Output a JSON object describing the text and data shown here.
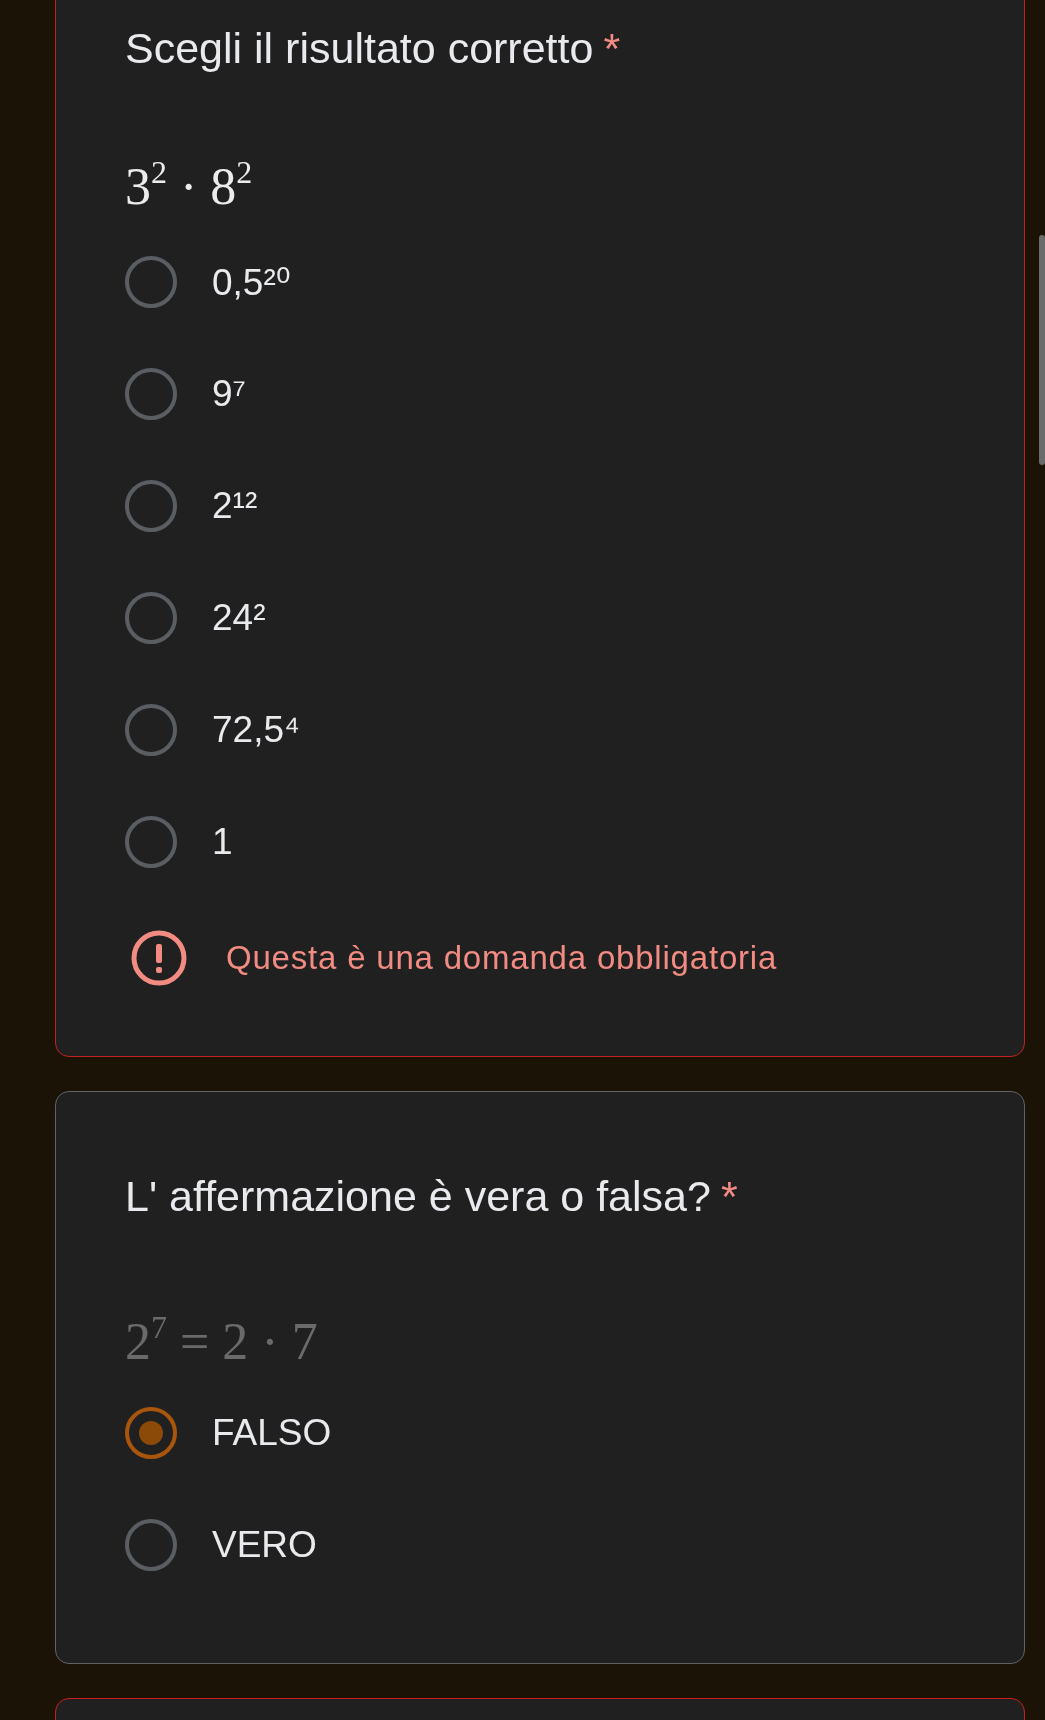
{
  "questions": [
    {
      "title": "Scegli il risultato corretto",
      "required_mark": "*",
      "formula": "3$^{2}$ · 8$^{2}$",
      "faint": false,
      "error": true,
      "options": [
        {
          "label": "0,5²⁰",
          "selected": false
        },
        {
          "label": "9⁷",
          "selected": false
        },
        {
          "label": "2¹²",
          "selected": false
        },
        {
          "label": "24²",
          "selected": false
        },
        {
          "label": "72,5⁴",
          "selected": false
        },
        {
          "label": "1",
          "selected": false
        }
      ],
      "error_message": "Questa è una domanda obbligatoria"
    },
    {
      "title": "L' affermazione è vera o falsa?",
      "required_mark": "*",
      "formula": "2$^{7}$ = 2 · 7",
      "faint": true,
      "error": false,
      "options": [
        {
          "label": "FALSO",
          "selected": true
        },
        {
          "label": "VERO",
          "selected": false
        }
      ]
    },
    {
      "error": true
    }
  ]
}
